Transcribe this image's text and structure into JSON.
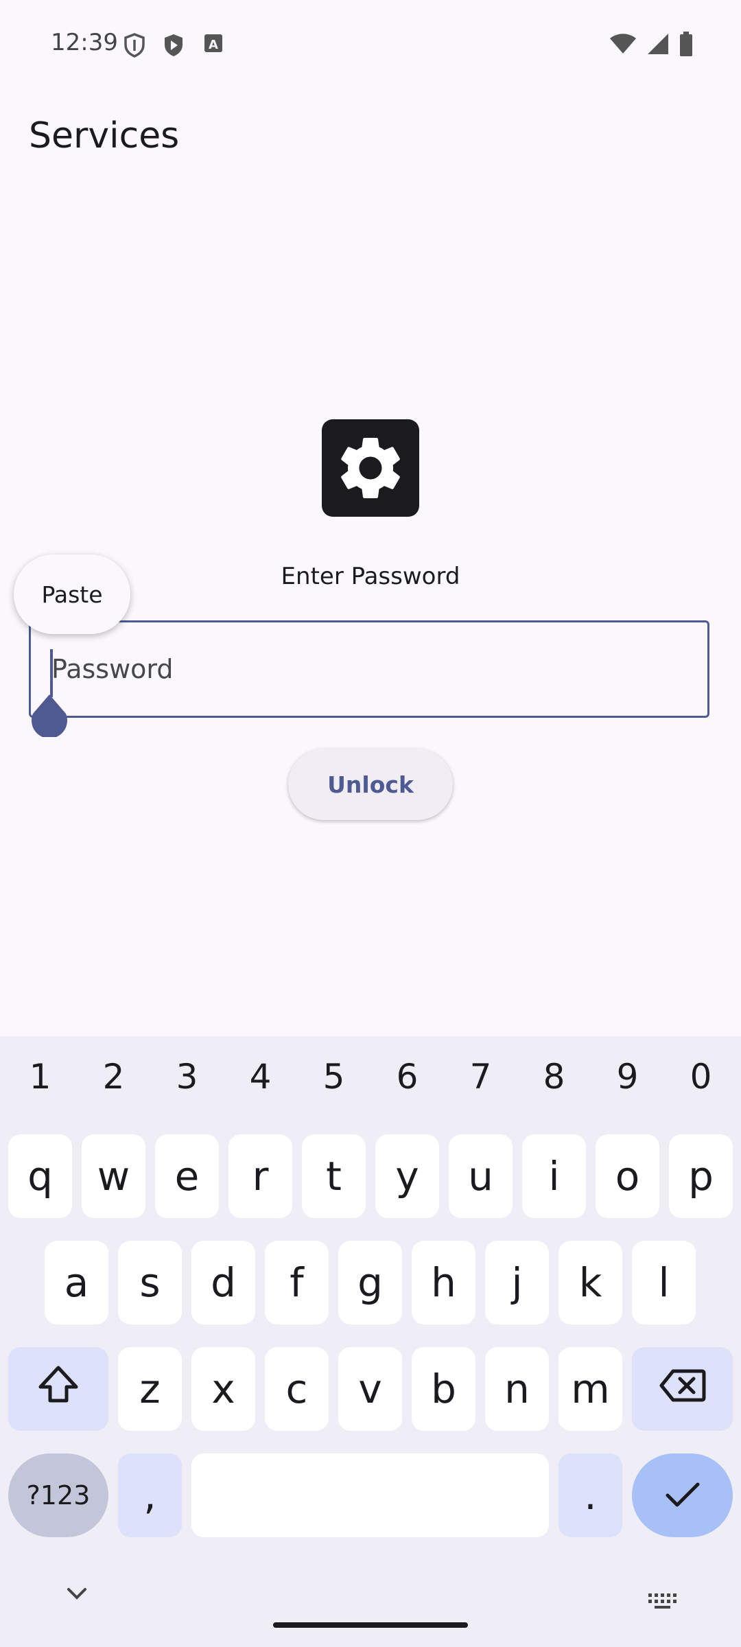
{
  "status_bar": {
    "time": "12:39",
    "left_icons": [
      "shield-outline-icon",
      "play-protect-icon",
      "text-a-icon"
    ],
    "right_icons": [
      "wifi-icon",
      "signal-icon",
      "battery-icon"
    ]
  },
  "app_bar": {
    "title": "Services"
  },
  "lock_screen": {
    "icon": "gear-icon",
    "prompt": "Enter Password",
    "password_placeholder": "Password",
    "password_value": "",
    "unlock_label": "Unlock",
    "paste_label": "Paste"
  },
  "keyboard": {
    "numbers": [
      "1",
      "2",
      "3",
      "4",
      "5",
      "6",
      "7",
      "8",
      "9",
      "0"
    ],
    "row1": [
      "q",
      "w",
      "e",
      "r",
      "t",
      "y",
      "u",
      "i",
      "o",
      "p"
    ],
    "row2": [
      "a",
      "s",
      "d",
      "f",
      "g",
      "h",
      "j",
      "k",
      "l"
    ],
    "row3": [
      "z",
      "x",
      "c",
      "v",
      "b",
      "n",
      "m"
    ],
    "symbols_label": "?123",
    "comma_label": ",",
    "period_label": "."
  },
  "colors": {
    "accent": "#4F5A92",
    "background": "#FBF8FD",
    "keyboard_bg": "#EFEDF6",
    "enter_key": "#A7C1F7"
  }
}
